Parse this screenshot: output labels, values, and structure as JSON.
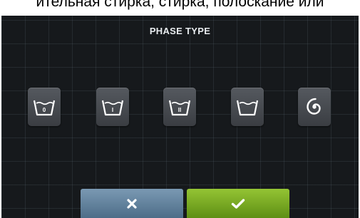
{
  "caption": {
    "text": "ительная стирка, стирка, полоскание или"
  },
  "screen": {
    "title": "PHASE TYPE"
  },
  "phase_options": [
    {
      "icon": "basin-prewash-icon",
      "mark": "0"
    },
    {
      "icon": "basin-wash-icon",
      "mark": "I"
    },
    {
      "icon": "basin-rinse-icon",
      "mark": "II"
    },
    {
      "icon": "basin-empty-icon",
      "mark": ""
    },
    {
      "icon": "spin-spiral-icon",
      "mark": ""
    }
  ],
  "actions": {
    "cancel_icon": "cross-icon",
    "confirm_icon": "check-icon"
  },
  "colors": {
    "screen_bg": "#16191c",
    "button_gray": "#4a4e54",
    "cancel_blue": "#5f809c",
    "confirm_green": "#78aa22",
    "icon_white": "#ffffff"
  }
}
